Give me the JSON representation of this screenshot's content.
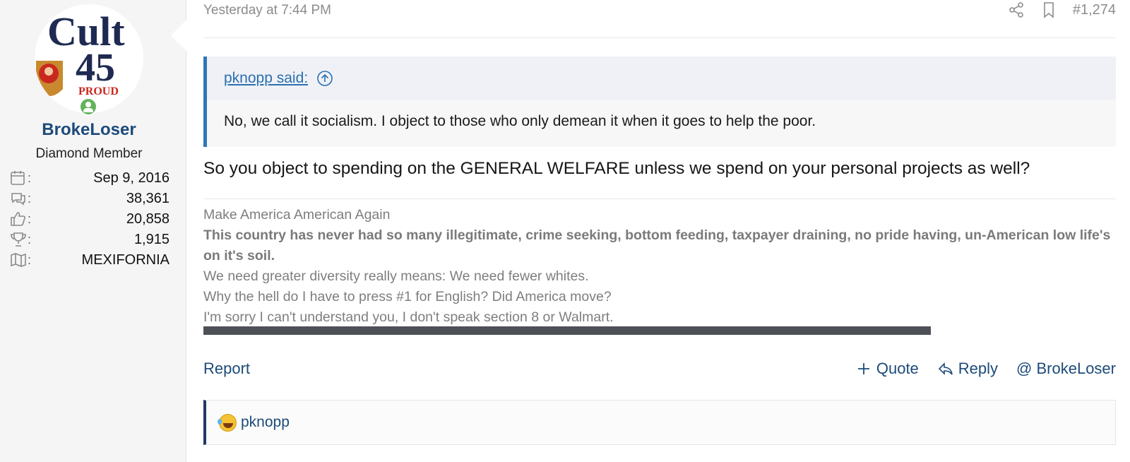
{
  "user": {
    "username": "BrokeLoser",
    "title": "Diamond Member",
    "avatar_text_top": "Cult",
    "avatar_text_num": "45",
    "avatar_text_bottom": "PROUD",
    "stats": [
      {
        "icon": "calendar-icon",
        "value": "Sep 9, 2016"
      },
      {
        "icon": "messages-icon",
        "value": "38,361"
      },
      {
        "icon": "thumbs-up-icon",
        "value": "20,858"
      },
      {
        "icon": "trophy-icon",
        "value": "1,915"
      },
      {
        "icon": "map-icon",
        "value": "MEXIFORNIA"
      }
    ]
  },
  "post": {
    "date": "Yesterday at 7:44 PM",
    "number": "#1,274",
    "quote": {
      "author": "pknopp said:",
      "text": "No, we call it socialism. I object to those who only demean it when it goes to help the poor."
    },
    "body": "So you object to spending on the GENERAL WELFARE unless we spend on your personal projects as well?",
    "signature": {
      "line1": "Make America American Again",
      "bold": "This country has never had so many illegitimate, crime seeking, bottom feeding, taxpayer draining, no pride having, un-American low life's on it's soil.",
      "line3": "We need greater diversity really means: We need fewer whites.",
      "line4": "Why the hell do I have to press #1 for English? Did America move?",
      "line5": "I'm sorry I can't understand you, I don't speak section 8 or Walmart."
    }
  },
  "actions": {
    "report": "Report",
    "quote": "Quote",
    "reply": "Reply",
    "mention": "@ BrokeLoser"
  },
  "reactions": {
    "user": "pknopp"
  },
  "colors": {
    "accent": "#2e77b6",
    "username": "#1d4a7a",
    "online": "#63b35c"
  }
}
